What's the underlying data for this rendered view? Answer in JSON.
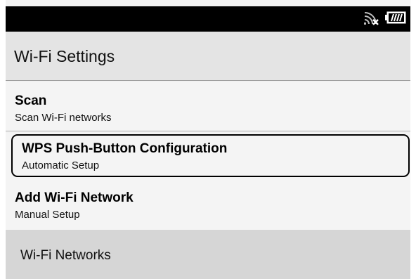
{
  "status_bar": {
    "icons": [
      "wifi-disconnected-icon",
      "battery-icon"
    ],
    "battery_level": 0.75
  },
  "header": {
    "title": "Wi-Fi Settings"
  },
  "menu": {
    "items": [
      {
        "title": "Scan",
        "subtitle": "Scan Wi-Fi networks"
      },
      {
        "title": "WPS Push-Button Configuration",
        "subtitle": "Automatic Setup",
        "focused": true
      },
      {
        "title": "Add Wi-Fi Network",
        "subtitle": "Manual Setup"
      }
    ]
  },
  "section": {
    "title": "Wi-Fi Networks"
  }
}
